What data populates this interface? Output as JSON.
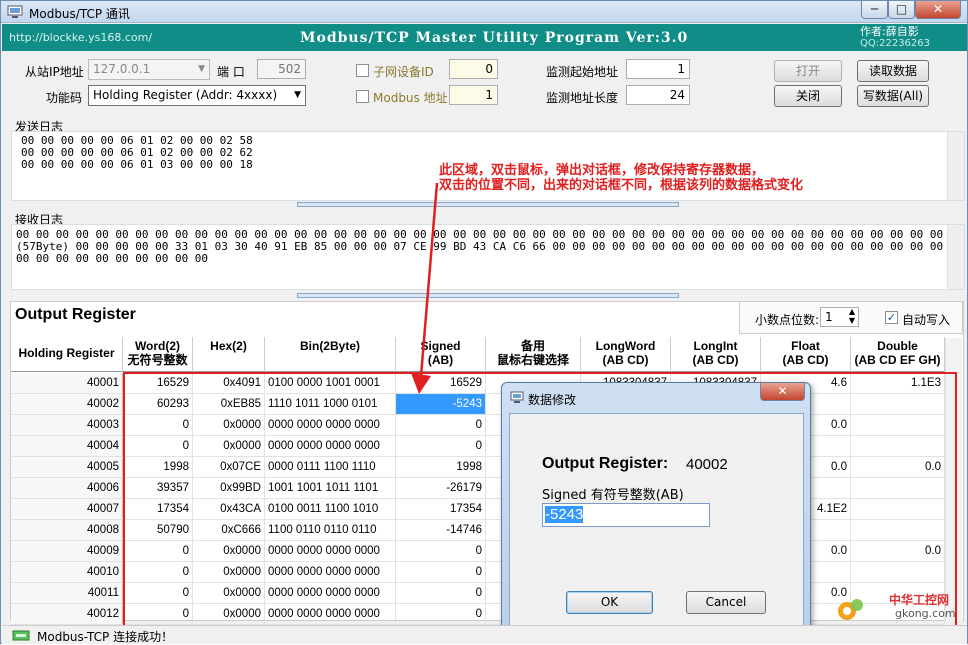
{
  "window": {
    "title": "Modbus/TCP 通讯",
    "min": "─",
    "max": "□",
    "close": "✕"
  },
  "banner": {
    "url": "http://blockke.ys168.com/",
    "program": "Modbus/TCP Master Utility Program  Ver:3.0",
    "author": "作者:薛自影",
    "qq": "QQ:22236263"
  },
  "conn": {
    "ip_label": "从站IP地址",
    "ip_value": "127.0.0.1",
    "port_label": "端 口",
    "port_value": "502",
    "func_label": "功能码",
    "func_value": "Holding Register (Addr: 4xxxx)",
    "subnet_label": "子网设备ID",
    "subnet_value": "0",
    "modbus_addr_label": "Modbus 地址",
    "modbus_addr_value": "1",
    "start_label": "监测起始地址",
    "start_value": "1",
    "len_label": "监测地址长度",
    "len_value": "24",
    "open_btn": "打开",
    "close_btn": "关闭",
    "read_btn": "读取数据",
    "write_btn": "写数据(All)"
  },
  "send_log": {
    "label": "发送日志",
    "lines": [
      "00 00 00 00 00 06 01 02 00 00 02 58",
      "00 00 00 00 00 06 01 02 00 00 02 62",
      "00 00 00 00 00 06 01 03 00 00 00 18"
    ]
  },
  "recv_log": {
    "label": "接收日志",
    "lines": [
      "00 00 00 00 00 00 00 00 00 00 00 00 00 00 00 00 00 00 00 00 00 00 00 00 00 00 00 00 00 00 00 00 00 00 00 00 00 00 00 00 00 00 00 00 00 00 00 00 00 00 00 00 00",
      "(57Byte) 00 00 00 00 00 33 01 03 30 40 91 EB 85 00 00 00 07 CE 99 BD 43 CA C6 66 00 00 00 00 00 00 00 00 00 00 00 00 00 00 00 00 00 00 00 00 00 00 00",
      "00 00 00 00 00 00 00 00 00 00"
    ]
  },
  "annotation": {
    "line1": "此区域，双击鼠标，弹出对话框，修改保持寄存器数据，",
    "line2": "双击的位置不同，出来的对话框不同，根据该列的数据格式变化"
  },
  "output": {
    "title": "Output Register",
    "decimals_label": "小数点位数:",
    "decimals_value": "1",
    "autowrite_label": "自动写入",
    "columns": [
      "Holding Register",
      "Word(2)\n无符号整数",
      "Hex(2)",
      "Bin(2Byte)",
      "Signed\n(AB)",
      "备用\n鼠标右键选择",
      "LongWord\n(AB CD)",
      "LongInt\n(AB CD)",
      "Float\n(AB CD)",
      "Double\n(AB CD EF GH)"
    ],
    "rows": [
      {
        "addr": "40001",
        "word": "16529",
        "hex": "0x4091",
        "bin": "0100 0000 1001 0001",
        "signed": "16529",
        "spare": "",
        "lword": "1083304837",
        "lint": "1083304837",
        "float": "4.6",
        "double": "1.1E3"
      },
      {
        "addr": "40002",
        "word": "60293",
        "hex": "0xEB85",
        "bin": "1110 1011 1000 0101",
        "signed": "-5243",
        "spare": "",
        "lword": "",
        "lint": "",
        "float": "",
        "double": ""
      },
      {
        "addr": "40003",
        "word": "0",
        "hex": "0x0000",
        "bin": "0000 0000 0000 0000",
        "signed": "0",
        "spare": "",
        "lword": "",
        "lint": "",
        "float": "0.0",
        "double": ""
      },
      {
        "addr": "40004",
        "word": "0",
        "hex": "0x0000",
        "bin": "0000 0000 0000 0000",
        "signed": "0",
        "spare": "",
        "lword": "",
        "lint": "",
        "float": "",
        "double": ""
      },
      {
        "addr": "40005",
        "word": "1998",
        "hex": "0x07CE",
        "bin": "0000 0111 1100 1110",
        "signed": "1998",
        "spare": "",
        "lword": "",
        "lint": "",
        "float": "0.0",
        "double": "0.0"
      },
      {
        "addr": "40006",
        "word": "39357",
        "hex": "0x99BD",
        "bin": "1001 1001 1011 1101",
        "signed": "-26179",
        "spare": "",
        "lword": "",
        "lint": "",
        "float": "",
        "double": ""
      },
      {
        "addr": "40007",
        "word": "17354",
        "hex": "0x43CA",
        "bin": "0100 0011 1100 1010",
        "signed": "17354",
        "spare": "",
        "lword": "",
        "lint": "",
        "float": "4.1E2",
        "double": ""
      },
      {
        "addr": "40008",
        "word": "50790",
        "hex": "0xC666",
        "bin": "1100 0110 0110 0110",
        "signed": "-14746",
        "spare": "",
        "lword": "",
        "lint": "",
        "float": "",
        "double": ""
      },
      {
        "addr": "40009",
        "word": "0",
        "hex": "0x0000",
        "bin": "0000 0000 0000 0000",
        "signed": "0",
        "spare": "",
        "lword": "",
        "lint": "",
        "float": "0.0",
        "double": "0.0"
      },
      {
        "addr": "40010",
        "word": "0",
        "hex": "0x0000",
        "bin": "0000 0000 0000 0000",
        "signed": "0",
        "spare": "",
        "lword": "",
        "lint": "",
        "float": "",
        "double": ""
      },
      {
        "addr": "40011",
        "word": "0",
        "hex": "0x0000",
        "bin": "0000 0000 0000 0000",
        "signed": "0",
        "spare": "",
        "lword": "",
        "lint": "",
        "float": "0.0",
        "double": ""
      },
      {
        "addr": "40012",
        "word": "0",
        "hex": "0x0000",
        "bin": "0000 0000 0000 0000",
        "signed": "0",
        "spare": "",
        "lword": "",
        "lint": "",
        "float": "",
        "double": ""
      }
    ]
  },
  "dialog": {
    "title": "数据修改",
    "close": "✕",
    "heading": "Output Register:",
    "register": "40002",
    "field_label": "Signed 有符号整数(AB)",
    "value": "-5243",
    "ok": "OK",
    "cancel": "Cancel"
  },
  "status": {
    "text": "Modbus-TCP 连接成功！"
  },
  "watermark": {
    "site": "中华工控网",
    "domain": "gkong.com"
  },
  "colors": {
    "banner": "#0f8d86",
    "annotation": "#e02020",
    "selection": "#3399ff"
  }
}
